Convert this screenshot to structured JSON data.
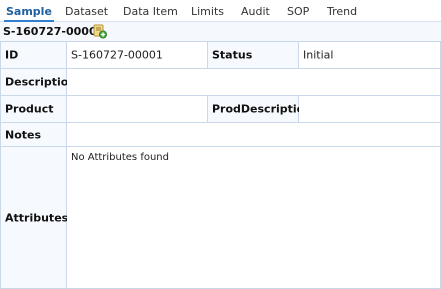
{
  "tabs": [
    "Sample",
    "Dataset",
    "Data Item",
    "Limits",
    "Audit",
    "SOP",
    "Trend"
  ],
  "header": {
    "title": "S-160727-00001",
    "action_icon": "edit-add-icon"
  },
  "record": {
    "id_label": "ID",
    "id_value": "S-160727-00001",
    "status_label": "Status",
    "status_value": "Initial",
    "description_label": "Description",
    "product_label": "Product",
    "prod_description_label": "ProdDescription",
    "notes_label": "Notes",
    "attributes_label": "Attributes",
    "attributes_empty_text": "No Attributes found"
  },
  "colors": {
    "accent": "#2f7fcf",
    "border": "#c9d9ea",
    "label_bg": "#f6f9fd"
  }
}
